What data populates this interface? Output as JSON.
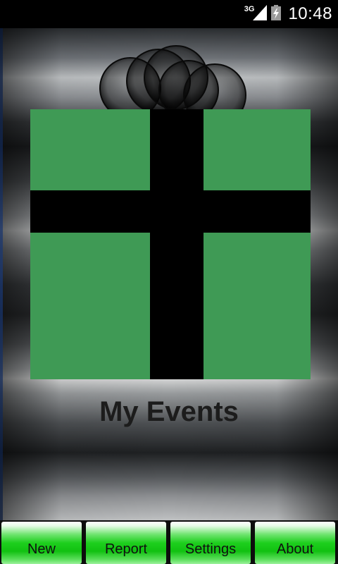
{
  "status_bar": {
    "network_type": "3G",
    "time": "10:48",
    "icons": [
      "signal-icon",
      "battery-charging-icon"
    ]
  },
  "app": {
    "title": "My Events",
    "logo": "gift-box-icon"
  },
  "buttons": {
    "new": "New",
    "report": "Report",
    "settings": "Settings",
    "about": "About"
  },
  "colors": {
    "gift_green": "#3f9a55",
    "ribbon": "#000000",
    "button_green": "#1ecf1e"
  }
}
